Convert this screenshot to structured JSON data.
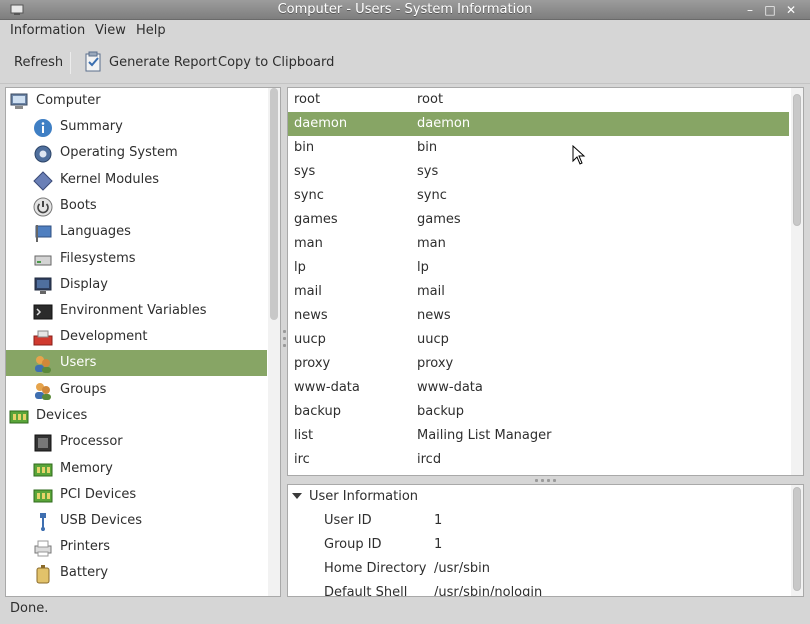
{
  "window": {
    "title": "Computer - Users - System Information"
  },
  "menu": [
    "Information",
    "View",
    "Help"
  ],
  "toolbar": {
    "refresh": "Refresh",
    "generate_report": "Generate Report",
    "copy": "Copy to Clipboard"
  },
  "sidebar": {
    "items": [
      {
        "label": "Computer",
        "icon": "computer-icon"
      },
      {
        "label": "Summary",
        "icon": "info-icon"
      },
      {
        "label": "Operating System",
        "icon": "gear-icon"
      },
      {
        "label": "Kernel Modules",
        "icon": "module-icon"
      },
      {
        "label": "Boots",
        "icon": "power-icon"
      },
      {
        "label": "Languages",
        "icon": "flag-icon"
      },
      {
        "label": "Filesystems",
        "icon": "drive-icon"
      },
      {
        "label": "Display",
        "icon": "monitor-icon"
      },
      {
        "label": "Environment Variables",
        "icon": "terminal-icon"
      },
      {
        "label": "Development",
        "icon": "development-icon"
      },
      {
        "label": "Users",
        "icon": "users-icon"
      },
      {
        "label": "Groups",
        "icon": "groups-icon"
      },
      {
        "label": "Devices",
        "icon": "devices-icon"
      },
      {
        "label": "Processor",
        "icon": "processor-icon"
      },
      {
        "label": "Memory",
        "icon": "memory-icon"
      },
      {
        "label": "PCI Devices",
        "icon": "pci-icon"
      },
      {
        "label": "USB Devices",
        "icon": "usb-icon"
      },
      {
        "label": "Printers",
        "icon": "printer-icon"
      },
      {
        "label": "Battery",
        "icon": "battery-icon"
      }
    ],
    "selected": "Users"
  },
  "users": [
    [
      "root",
      "root"
    ],
    [
      "daemon",
      "daemon"
    ],
    [
      "bin",
      "bin"
    ],
    [
      "sys",
      "sys"
    ],
    [
      "sync",
      "sync"
    ],
    [
      "games",
      "games"
    ],
    [
      "man",
      "man"
    ],
    [
      "lp",
      "lp"
    ],
    [
      "mail",
      "mail"
    ],
    [
      "news",
      "news"
    ],
    [
      "uucp",
      "uucp"
    ],
    [
      "proxy",
      "proxy"
    ],
    [
      "www-data",
      "www-data"
    ],
    [
      "backup",
      "backup"
    ],
    [
      "list",
      "Mailing List Manager"
    ],
    [
      "irc",
      "ircd"
    ]
  ],
  "details": {
    "heading": "User Information",
    "rows": [
      {
        "key": "User ID",
        "value": "1"
      },
      {
        "key": "Group ID",
        "value": "1"
      },
      {
        "key": "Home Directory",
        "value": "/usr/sbin"
      },
      {
        "key": "Default Shell",
        "value": "/usr/sbin/nologin"
      }
    ]
  },
  "status": "Done.",
  "colors": {
    "selection": "#87a565",
    "titlebar": "#8c8c8c"
  }
}
